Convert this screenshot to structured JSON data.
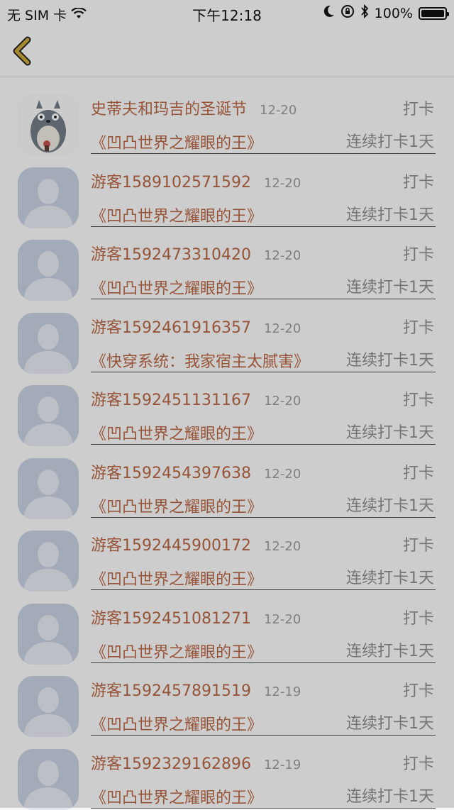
{
  "status_bar": {
    "carrier": "无 SIM 卡",
    "time": "下午12:18",
    "battery_percent": "100%",
    "battery_level": 100
  },
  "nav": {
    "back_icon": "chevron-left-icon",
    "accent": "#c9a53a"
  },
  "colors": {
    "name": "#b56544",
    "meta": "#8c8c8c"
  },
  "items": [
    {
      "name": "史蒂夫和玛吉的圣诞节",
      "date": "12-20",
      "action": "打卡",
      "book": "《凹凸世界之耀眼的王》",
      "streak": "连续打卡1天",
      "avatar": "totoro-avatar"
    },
    {
      "name": "游客1589102571592",
      "date": "12-20",
      "action": "打卡",
      "book": "《凹凸世界之耀眼的王》",
      "streak": "连续打卡1天",
      "avatar": "default-avatar"
    },
    {
      "name": "游客1592473310420",
      "date": "12-20",
      "action": "打卡",
      "book": "《凹凸世界之耀眼的王》",
      "streak": "连续打卡1天",
      "avatar": "default-avatar"
    },
    {
      "name": "游客1592461916357",
      "date": "12-20",
      "action": "打卡",
      "book": "《快穿系统：我家宿主太腻害》",
      "streak": "连续打卡1天",
      "avatar": "default-avatar"
    },
    {
      "name": "游客1592451131167",
      "date": "12-20",
      "action": "打卡",
      "book": "《凹凸世界之耀眼的王》",
      "streak": "连续打卡1天",
      "avatar": "default-avatar"
    },
    {
      "name": "游客1592454397638",
      "date": "12-20",
      "action": "打卡",
      "book": "《凹凸世界之耀眼的王》",
      "streak": "连续打卡1天",
      "avatar": "default-avatar"
    },
    {
      "name": "游客1592445900172",
      "date": "12-20",
      "action": "打卡",
      "book": "《凹凸世界之耀眼的王》",
      "streak": "连续打卡1天",
      "avatar": "default-avatar"
    },
    {
      "name": "游客1592451081271",
      "date": "12-20",
      "action": "打卡",
      "book": "《凹凸世界之耀眼的王》",
      "streak": "连续打卡1天",
      "avatar": "default-avatar"
    },
    {
      "name": "游客1592457891519",
      "date": "12-19",
      "action": "打卡",
      "book": "《凹凸世界之耀眼的王》",
      "streak": "连续打卡1天",
      "avatar": "default-avatar"
    },
    {
      "name": "游客1592329162896",
      "date": "12-19",
      "action": "打卡",
      "book": "《凹凸世界之耀眼的王》",
      "streak": "连续打卡1天",
      "avatar": "default-avatar"
    }
  ]
}
